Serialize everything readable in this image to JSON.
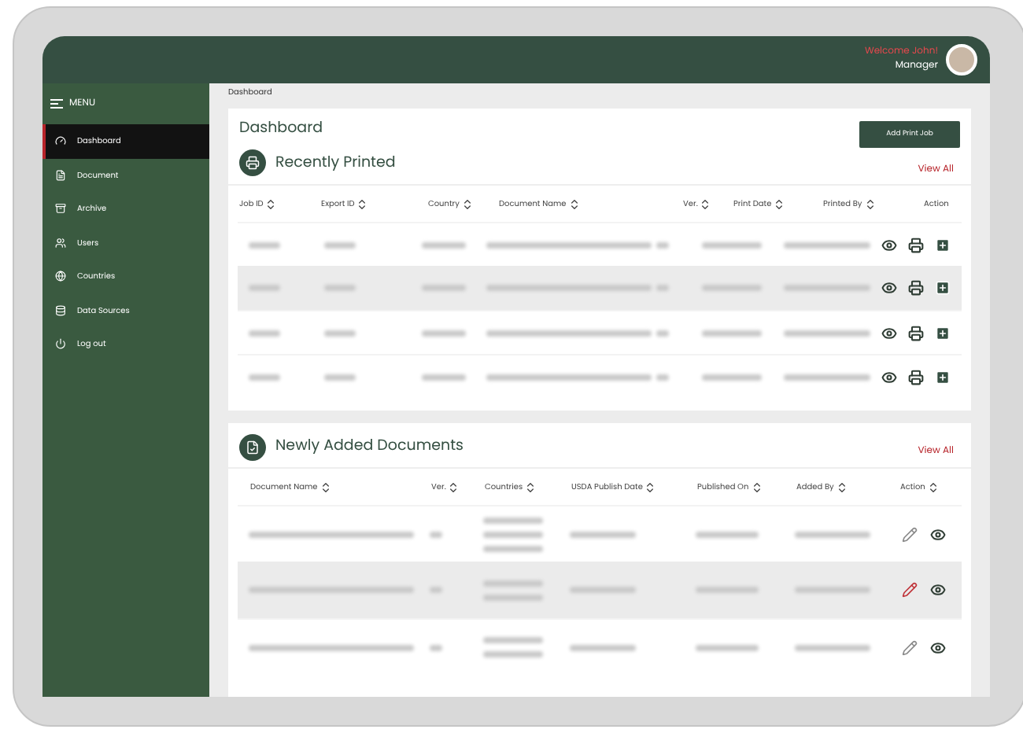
{
  "header": {
    "welcome": "Welcome John!",
    "role": "Manager"
  },
  "sidebar": {
    "title": "MENU",
    "items": [
      {
        "label": "Dashboard",
        "selected": true
      },
      {
        "label": "Document",
        "selected": false
      },
      {
        "label": "Archive",
        "selected": false
      },
      {
        "label": "Users",
        "selected": false
      },
      {
        "label": "Countries",
        "selected": false
      },
      {
        "label": "Data Sources",
        "selected": false
      },
      {
        "label": "Log out",
        "selected": false
      }
    ]
  },
  "breadcrumb": "Dashboard",
  "page_title": "Dashboard",
  "add_button": "Add Print Job",
  "recently_printed": {
    "title": "Recently Printed",
    "view_all": "View All",
    "columns": [
      {
        "label": "Job ID",
        "sortable": true
      },
      {
        "label": "Export ID",
        "sortable": true
      },
      {
        "label": "Country",
        "sortable": true
      },
      {
        "label": "Document Name",
        "sortable": true
      },
      {
        "label": "Ver.",
        "sortable": true
      },
      {
        "label": "Print Date",
        "sortable": true
      },
      {
        "label": "Printed By",
        "sortable": true
      },
      {
        "label": "Action",
        "sortable": false
      }
    ],
    "rows": [
      {
        "selected": false
      },
      {
        "selected": true
      },
      {
        "selected": false
      },
      {
        "selected": false
      }
    ]
  },
  "newly_added": {
    "title": "Newly Added Documents",
    "view_all": "View All",
    "columns": [
      {
        "label": "Document Name",
        "sortable": true
      },
      {
        "label": "Ver.",
        "sortable": true
      },
      {
        "label": "Countries",
        "sortable": true
      },
      {
        "label": "USDA Publish Date",
        "sortable": true
      },
      {
        "label": "Published On",
        "sortable": true
      },
      {
        "label": "Added By",
        "sortable": true
      },
      {
        "label": "Action",
        "sortable": true
      }
    ],
    "rows": [
      {
        "selected": false
      },
      {
        "selected": true
      },
      {
        "selected": false
      }
    ]
  }
}
